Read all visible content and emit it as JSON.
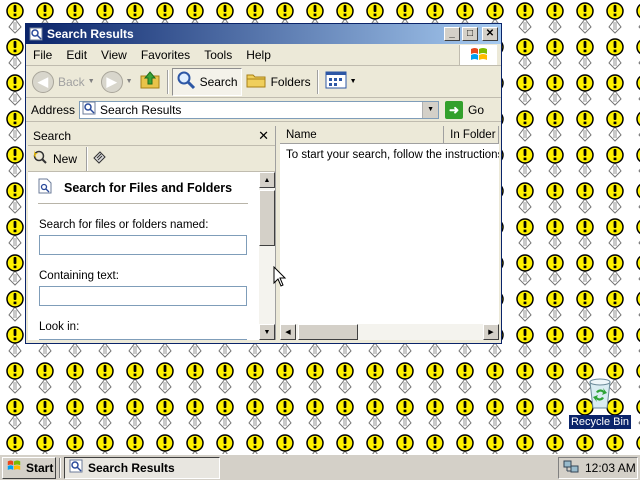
{
  "window": {
    "title": "Search Results",
    "controls": {
      "minimize": "_",
      "maximize": "□",
      "close": "✕"
    }
  },
  "menu": [
    "File",
    "Edit",
    "View",
    "Favorites",
    "Tools",
    "Help"
  ],
  "toolbar": {
    "back_label": "Back",
    "search_label": "Search",
    "folders_label": "Folders"
  },
  "address": {
    "label": "Address",
    "value": "Search Results",
    "go_label": "Go"
  },
  "search_pane": {
    "header": "Search",
    "close_glyph": "✕",
    "new_label": "New",
    "heading": "Search for Files and Folders",
    "named_label": "Search for files or folders named:",
    "named_value": "",
    "containing_label": "Containing text:",
    "containing_value": "",
    "lookin_label": "Look in:"
  },
  "results": {
    "columns": [
      "Name",
      "In Folder"
    ],
    "message": "To start your search, follow the instructions in the left pane."
  },
  "desktop": {
    "recycle_bin_label": "Recycle Bin",
    "wallpaper_icon": "exclamation-bulb-icon"
  },
  "taskbar": {
    "start_label": "Start",
    "task_label": "Search Results",
    "clock": "12:03 AM"
  },
  "colors": {
    "title_gradient_start": "#0a246a",
    "title_gradient_end": "#a6caf0",
    "face": "#ece9d8",
    "go_green": "#33a02c",
    "bulb_yellow": "#fff200"
  }
}
